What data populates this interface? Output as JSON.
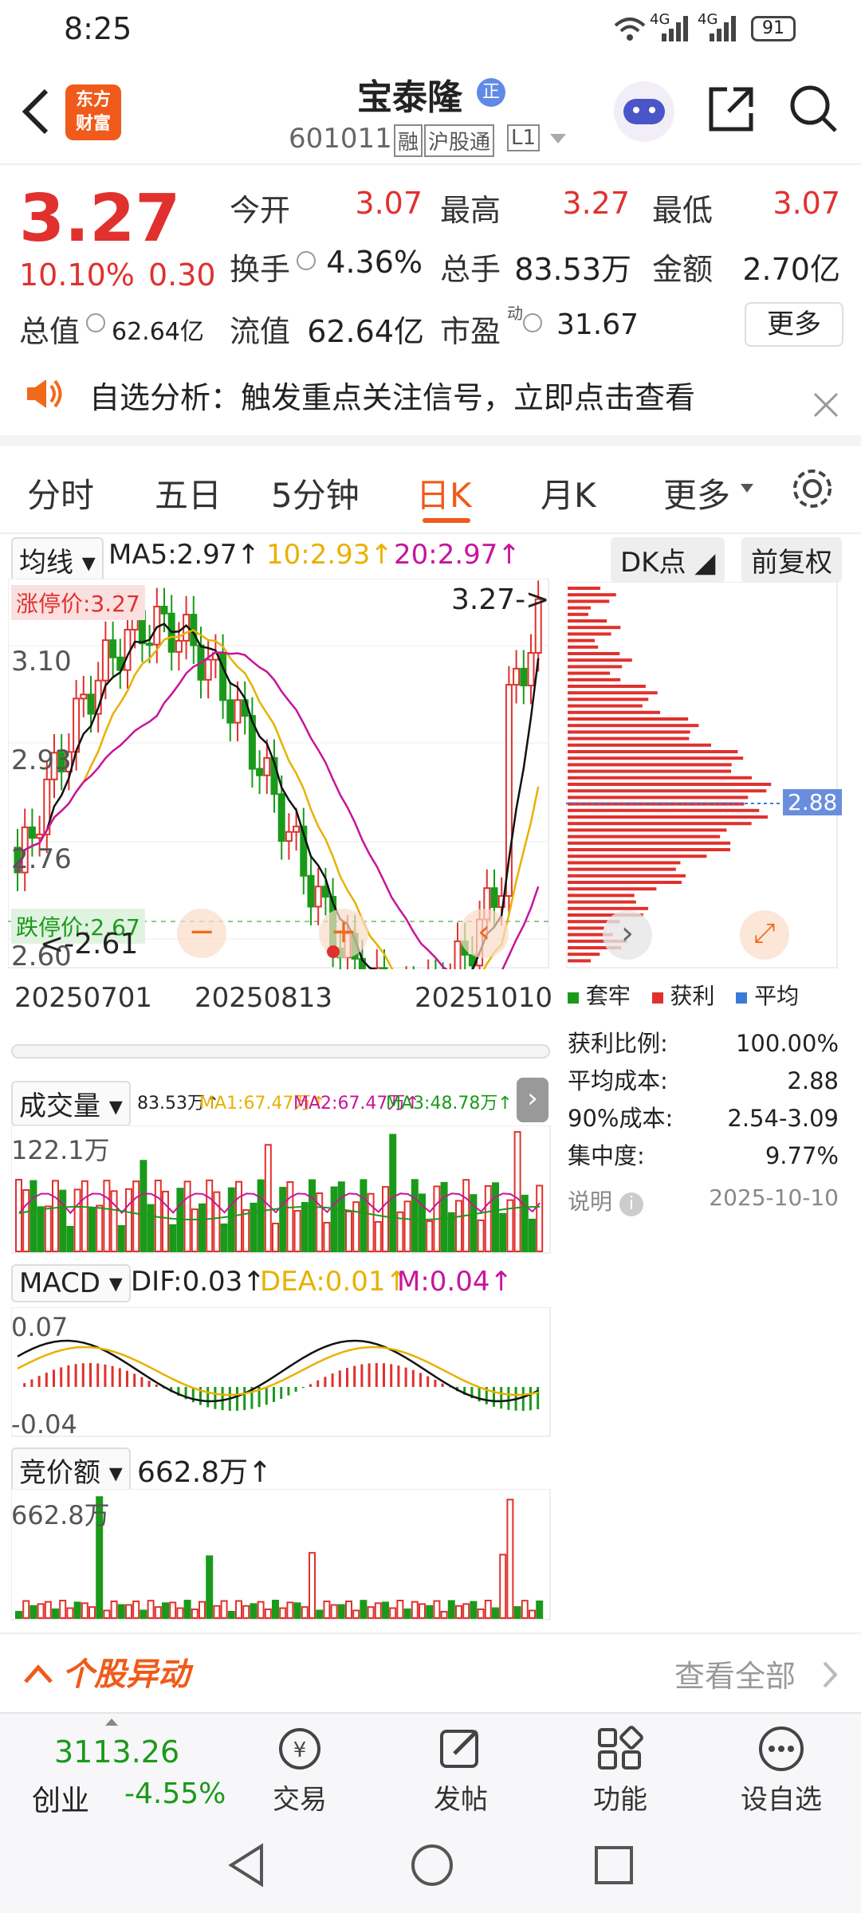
{
  "status": {
    "time": "8:25",
    "net1": "4G",
    "net2": "4G",
    "battery": "91"
  },
  "header": {
    "brand_line1": "东方",
    "brand_line2": "财富",
    "name": "宝泰隆",
    "name_badge": "正",
    "code": "601011",
    "tag_margin": "融",
    "tag_connect": "沪股通",
    "tag_level": "L1"
  },
  "quote": {
    "price": "3.27",
    "change_pct": "10.10%",
    "change_amt": "0.30",
    "open_label": "今开",
    "open": "3.07",
    "high_label": "最高",
    "high": "3.27",
    "low_label": "最低",
    "low": "3.07",
    "turnover_label": "换手",
    "turnover": "4.36%",
    "volume_label": "总手",
    "volume": "83.53万",
    "amount_label": "金额",
    "amount": "2.70亿",
    "mktcap_label": "总值",
    "mktcap": "62.64亿",
    "float_label": "流值",
    "float": "62.64亿",
    "pe_label": "市盈",
    "pe_sup": "动",
    "pe": "31.67",
    "more_label": "更多"
  },
  "notice": {
    "text": "自选分析：触发重点关注信号，立即点击查看"
  },
  "tabs": [
    "分时",
    "五日",
    "5分钟",
    "日K",
    "月K",
    "更多"
  ],
  "tab_active": 3,
  "kline": {
    "indicator": "均线",
    "ma5": "MA5:2.97↑",
    "ma10": "10:2.93↑",
    "ma20": "20:2.97↑",
    "dk_label": "DK点",
    "adjust_label": "前复权",
    "limit_up": "涨停价:3.27",
    "limit_down": "跌停价:2.67",
    "y_labels": [
      "3.10",
      "2.93",
      "2.76",
      "2.60"
    ],
    "last_price_tag": "3.27->",
    "low_tag": "<-2.61",
    "dates": [
      "20250701",
      "20250813",
      "20251010"
    ],
    "chip_avg": "2.88",
    "colors": {
      "up": "#e0312e",
      "down": "#1a9a1a",
      "ma5": "#111111",
      "ma10": "#e8b100",
      "ma20": "#c8149c"
    }
  },
  "chip": {
    "legend": [
      "套牢",
      "获利",
      "平均"
    ],
    "rows": [
      {
        "label": "获利比例:",
        "value": "100.00%"
      },
      {
        "label": "平均成本:",
        "value": "2.88"
      },
      {
        "label": "90%成本:",
        "value": "2.54-3.09"
      },
      {
        "label": "集中度:",
        "value": "9.77%"
      }
    ],
    "note_label": "说明",
    "note_date": "2025-10-10"
  },
  "volume": {
    "label": "成交量",
    "val": "83.53万↑",
    "ma1": "MA1:67.47万↑",
    "ma2": "MA2:67.47万↑",
    "ma3": "MA3:48.78万↑",
    "max": "122.1万"
  },
  "macd": {
    "label": "MACD",
    "dif": "DIF:0.03↑",
    "dea": "DEA:0.01↑",
    "m": "M:0.04↑",
    "top": "0.07",
    "bottom": "-0.04"
  },
  "auction": {
    "label": "竞价额",
    "val": "662.8万↑",
    "max": "662.8万"
  },
  "movement": {
    "title": "个股异动",
    "view_all": "查看全部"
  },
  "bottom_nav": {
    "index_value": "3113.26",
    "index_name": "创业",
    "index_change": "-4.55%",
    "items": [
      "交易",
      "发帖",
      "功能",
      "设自选"
    ]
  }
}
